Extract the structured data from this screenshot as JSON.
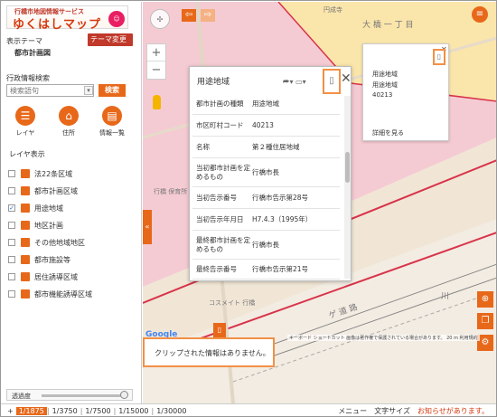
{
  "brand": {
    "subtitle": "行橋市地図情報サービス",
    "name": "ゆくはしマップ"
  },
  "sidebar": {
    "theme_label": "表示テーマ",
    "theme_change_label": "テーマ変更 ▶",
    "theme_name": "都市計画図",
    "search_label": "行政情報検索",
    "search_placeholder": "検索語句",
    "search_button": "検索",
    "nav": [
      {
        "label": "レイヤ",
        "icon": "list-icon"
      },
      {
        "label": "住所",
        "icon": "home-icon"
      },
      {
        "label": "情報一覧",
        "icon": "table-icon"
      }
    ],
    "layers_heading": "レイヤ表示",
    "layers": [
      {
        "label": "法22条区域",
        "checked": false
      },
      {
        "label": "都市計画区域",
        "checked": false
      },
      {
        "label": "用途地域",
        "checked": true
      },
      {
        "label": "地区計画",
        "checked": false
      },
      {
        "label": "その他地域地区",
        "checked": false
      },
      {
        "label": "都市施設等",
        "checked": false
      },
      {
        "label": "居住誘導区域",
        "checked": false
      },
      {
        "label": "都市機能誘導区域",
        "checked": false
      }
    ],
    "opacity_label": "透過度",
    "opacity_value": 1.0
  },
  "map": {
    "labels": {
      "area": "大 橋 一 丁 目",
      "shop1": "円成寺",
      "bldg": "コスメイト 行橋",
      "road": "ゲ 道 路",
      "rail": "川",
      "school": "行橋 保育所"
    },
    "attribution": "キーボード ショートカット  画像は著作権で保護されている場合があります。  20 m  利用規約",
    "google": "Google"
  },
  "popup": {
    "title": "用途地域",
    "rows": [
      {
        "key": "都市計画の種類",
        "value": "用途地域"
      },
      {
        "key": "市区町村コード",
        "value": "40213"
      },
      {
        "key": "名称",
        "value": "第２種住居地域"
      },
      {
        "key": "当初都市計画を定めるもの",
        "value": "行橋市長"
      },
      {
        "key": "当初告示番号",
        "value": "行橋市告示第28号"
      },
      {
        "key": "当初告示年月日",
        "value": "H7.4.3（1995年）"
      },
      {
        "key": "最終都市計画を定めるもの",
        "value": "行橋市長"
      },
      {
        "key": "最終告示番号",
        "value": "行橋市告示第21号"
      }
    ]
  },
  "mini_popup": {
    "line1": "用途地域",
    "line2": "用途地域",
    "line3": "40213",
    "more": "詳細を見る"
  },
  "clip": {
    "message": "クリップされた情報はありません。"
  },
  "scales": [
    "1/1875",
    "1/3750",
    "1/7500",
    "1/15000",
    "1/30000"
  ],
  "bottom": {
    "menu": "メニュー",
    "font_size": "文字サイズ",
    "notice": "お知らせがあります。"
  },
  "colors": {
    "accent": "#e8681a",
    "zone_pink": "#f7c6d1",
    "zone_yellow": "#fbeaa3",
    "boundary": "#d8334a"
  }
}
